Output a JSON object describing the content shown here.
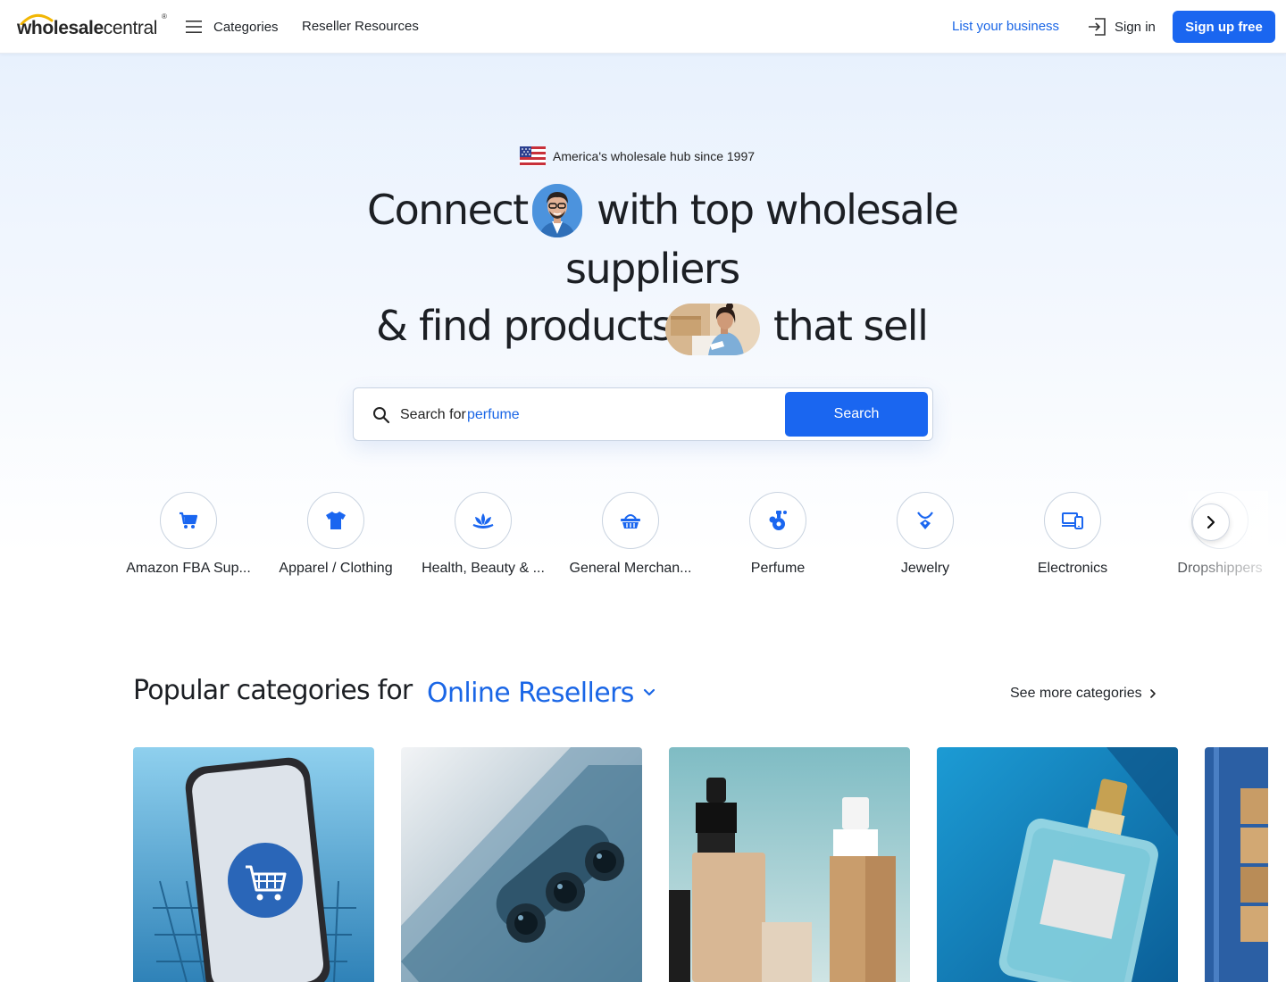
{
  "header": {
    "logo_bold": "wholesale",
    "logo_light": "central",
    "logo_mark": "®",
    "categories_label": "Categories",
    "resources_label": "Reseller Resources",
    "list_business_label": "List your business",
    "signin_label": "Sign in",
    "signup_label": "Sign up free"
  },
  "hero": {
    "tagline": "America's wholesale hub since 1997",
    "headline": {
      "connect": "Connect",
      "with_top": "with top wholesale",
      "suppliers": "suppliers",
      "amp": "&",
      "find_products": "find products",
      "that_sell": "that sell"
    }
  },
  "search": {
    "prefix": "Search for",
    "suggestion": "perfume",
    "button_label": "Search"
  },
  "categories": [
    {
      "label": "Amazon FBA Sup...",
      "icon": "cart-icon"
    },
    {
      "label": "Apparel / Clothing",
      "icon": "tshirt-icon"
    },
    {
      "label": "Health, Beauty & ...",
      "icon": "lotus-icon"
    },
    {
      "label": "General Merchan...",
      "icon": "basket-icon"
    },
    {
      "label": "Perfume",
      "icon": "perfume-icon"
    },
    {
      "label": "Jewelry",
      "icon": "necklace-icon"
    },
    {
      "label": "Electronics",
      "icon": "devices-icon"
    },
    {
      "label": "Dropshippers",
      "icon": "box-icon"
    }
  ],
  "popular": {
    "title": "Popular categories for",
    "audience": "Online Resellers",
    "see_more": "See more categories"
  },
  "colors": {
    "brand_blue": "#1a66f0",
    "link_blue": "#1a66e6",
    "logo_arc": "#f2b705"
  }
}
